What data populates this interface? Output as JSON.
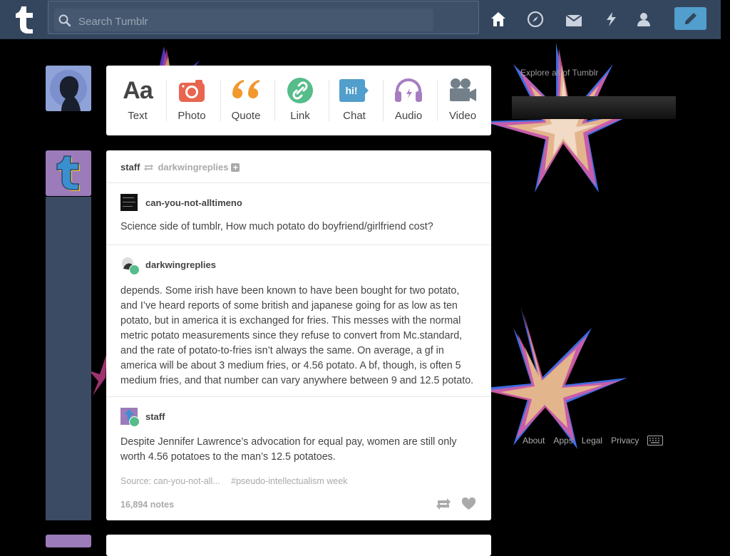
{
  "header": {
    "search_placeholder": "Search Tumblr",
    "nav": [
      "home-icon",
      "explore-icon",
      "inbox-icon",
      "activity-icon",
      "account-icon"
    ],
    "compose": "compose-pencil-icon",
    "accent": "#529ecc"
  },
  "post_types": [
    {
      "label": "Text",
      "icon": "text-icon",
      "color": "#444444"
    },
    {
      "label": "Photo",
      "icon": "camera-icon",
      "color": "#e8664f"
    },
    {
      "label": "Quote",
      "icon": "quote-icon",
      "color": "#f2992e"
    },
    {
      "label": "Link",
      "icon": "link-icon",
      "color": "#56bc8a"
    },
    {
      "label": "Chat",
      "icon": "chat-icon",
      "color": "#529ecc"
    },
    {
      "label": "Audio",
      "icon": "headphones-icon",
      "color": "#a77dc2"
    },
    {
      "label": "Video",
      "icon": "video-camera-icon",
      "color": "#748089"
    }
  ],
  "post": {
    "reblogger": "staff",
    "reblogged_from": "darkwingreplies",
    "thread": [
      {
        "user": "can-you-not-alltimeno",
        "text": "Science side of tumblr, How much potato do boyfriend/girlfriend cost?"
      },
      {
        "user": "darkwingreplies",
        "text": "depends. Some irish have been known to have been bought for two potato, and I’ve heard reports of some british and japanese going for as low as ten potato, but in america it is exchanged for fries. This messes with the normal metric potato measurements since they refuse to convert from Mc.standard, and the rate of potato-to-fries isn’t always the same. On average, a gf in america will be about 3 medium fries, or 4.56 potato. A bf, though, is often 5 medium fries, and that number can vary anywhere between 9 and 12.5 potato."
      },
      {
        "user": "staff",
        "text": "Despite Jennifer Lawrence’s advocation for equal pay, women are still only worth 4.56 potatoes to the man’s 12.5 potatoes."
      }
    ],
    "source": "Source: can-you-not-all...",
    "tags": "#pseudo-intellectualism week",
    "notes": "16,894 notes"
  },
  "sidebar": {
    "explore": "Explore all of Tumblr",
    "footer": [
      "About",
      "Apps",
      "Legal",
      "Privacy"
    ]
  }
}
